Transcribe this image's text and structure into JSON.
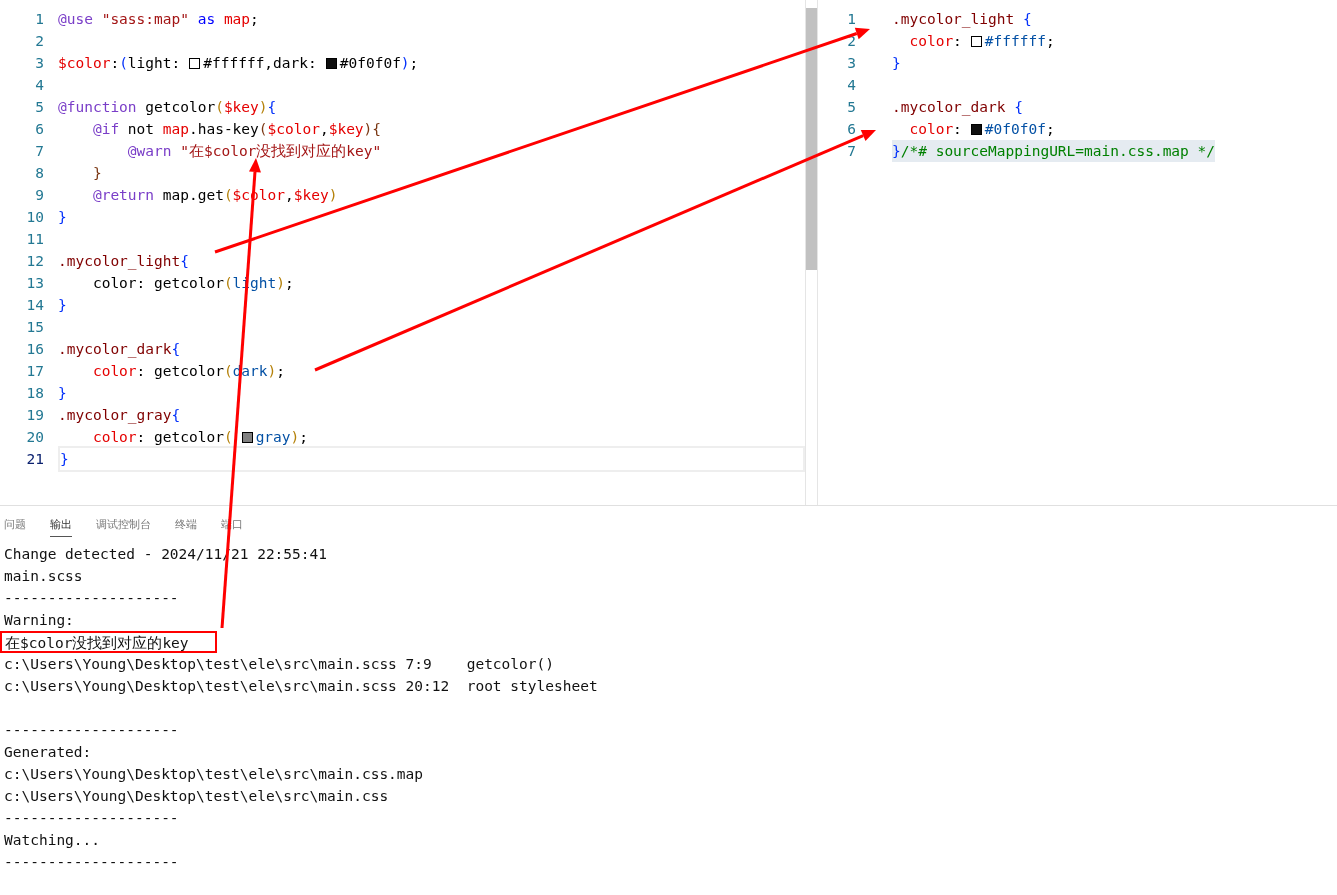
{
  "left_editor": {
    "lines": [
      {
        "number": "1",
        "current": false,
        "tokens": [
          {
            "t": "@use",
            "kind": "at"
          },
          {
            "t": " \"sass:map\"",
            "kind": "str"
          },
          {
            "t": " as",
            "kind": "kw"
          },
          {
            "t": " map",
            "kind": "var"
          },
          {
            "t": ";",
            "kind": "plain"
          }
        ]
      },
      {
        "number": "2",
        "current": false
      },
      {
        "number": "3",
        "current": false,
        "tokens": [
          {
            "t": "$color",
            "kind": "var"
          },
          {
            "t": ":",
            "kind": "plain"
          },
          {
            "t": "(",
            "kind": "b1"
          },
          {
            "t": "light:",
            "kind": "plain"
          },
          {
            "kind": "swatch",
            "color": "#ffffff"
          },
          {
            "t": "#ffffff,dark:",
            "kind": "plain"
          },
          {
            "kind": "swatch",
            "color": "#0f0f0f"
          },
          {
            "t": "#0f0f0f",
            "kind": "plain"
          },
          {
            "t": ")",
            "kind": "b1"
          },
          {
            "t": ";",
            "kind": "plain"
          }
        ]
      },
      {
        "number": "4",
        "current": false
      },
      {
        "number": "5",
        "current": false,
        "tokens": [
          {
            "t": "@function",
            "kind": "at"
          },
          {
            "t": " getcolor",
            "kind": "plain"
          },
          {
            "t": "(",
            "kind": "b2"
          },
          {
            "t": "$key",
            "kind": "var"
          },
          {
            "t": ")",
            "kind": "b2"
          },
          {
            "t": "{",
            "kind": "b1"
          }
        ]
      },
      {
        "number": "6",
        "current": false,
        "tokens": [
          {
            "t": "    @if",
            "kind": "at"
          },
          {
            "t": " not ",
            "kind": "plain"
          },
          {
            "t": "map",
            "kind": "var"
          },
          {
            "t": ".has-key",
            "kind": "plain"
          },
          {
            "t": "(",
            "kind": "b3"
          },
          {
            "t": "$color",
            "kind": "var"
          },
          {
            "t": ",",
            "kind": "plain"
          },
          {
            "t": "$key",
            "kind": "var"
          },
          {
            "t": ")",
            "kind": "b3"
          },
          {
            "t": "{",
            "kind": "b3"
          }
        ]
      },
      {
        "number": "7",
        "current": false,
        "tokens": [
          {
            "t": "        @warn",
            "kind": "at"
          },
          {
            "t": " \"在$color没找到对应的key\"",
            "kind": "str"
          }
        ]
      },
      {
        "number": "8",
        "current": false,
        "tokens": [
          {
            "t": "    }",
            "kind": "b3"
          }
        ]
      },
      {
        "number": "9",
        "current": false,
        "tokens": [
          {
            "t": "    @return",
            "kind": "at"
          },
          {
            "t": " map.get",
            "kind": "plain"
          },
          {
            "t": "(",
            "kind": "b2"
          },
          {
            "t": "$color",
            "kind": "var"
          },
          {
            "t": ",",
            "kind": "plain"
          },
          {
            "t": "$key",
            "kind": "var"
          },
          {
            "t": ")",
            "kind": "b2"
          }
        ]
      },
      {
        "number": "10",
        "current": false,
        "tokens": [
          {
            "t": "}",
            "kind": "b1"
          }
        ]
      },
      {
        "number": "11",
        "current": false
      },
      {
        "number": "12",
        "current": false,
        "tokens": [
          {
            "t": ".mycolor_light",
            "kind": "sel"
          },
          {
            "t": "{",
            "kind": "b1"
          }
        ]
      },
      {
        "number": "13",
        "current": false,
        "tokens": [
          {
            "t": "    color: getcolor",
            "kind": "plain"
          },
          {
            "t": "(",
            "kind": "b2"
          },
          {
            "t": "light",
            "kind": "val"
          },
          {
            "t": ")",
            "kind": "b2"
          },
          {
            "t": ";",
            "kind": "plain"
          }
        ]
      },
      {
        "number": "14",
        "current": false,
        "tokens": [
          {
            "t": "}",
            "kind": "b1"
          }
        ]
      },
      {
        "number": "15",
        "current": false
      },
      {
        "number": "16",
        "current": false,
        "tokens": [
          {
            "t": ".mycolor_dark",
            "kind": "sel"
          },
          {
            "t": "{",
            "kind": "b1"
          }
        ]
      },
      {
        "number": "17",
        "current": false,
        "tokens": [
          {
            "t": "    color",
            "kind": "prop"
          },
          {
            "t": ": getcolor",
            "kind": "plain"
          },
          {
            "t": "(",
            "kind": "b2"
          },
          {
            "t": "dark",
            "kind": "val"
          },
          {
            "t": ")",
            "kind": "b2"
          },
          {
            "t": ";",
            "kind": "plain"
          }
        ]
      },
      {
        "number": "18",
        "current": false,
        "tokens": [
          {
            "t": "}",
            "kind": "b1"
          }
        ]
      },
      {
        "number": "19",
        "current": false,
        "tokens": [
          {
            "t": ".mycolor_gray",
            "kind": "sel"
          },
          {
            "t": "{",
            "kind": "b1"
          }
        ]
      },
      {
        "number": "20",
        "current": false,
        "tokens": [
          {
            "t": "    color",
            "kind": "prop"
          },
          {
            "t": ": getcolor",
            "kind": "plain"
          },
          {
            "t": "(",
            "kind": "b2"
          },
          {
            "kind": "swatch",
            "color": "#808080"
          },
          {
            "t": "gray",
            "kind": "val"
          },
          {
            "t": ")",
            "kind": "b2"
          },
          {
            "t": ";",
            "kind": "plain"
          }
        ]
      },
      {
        "number": "21",
        "current": true,
        "tokens": [
          {
            "t": "}",
            "kind": "b1"
          }
        ]
      }
    ]
  },
  "right_editor": {
    "lines": [
      {
        "number": "1",
        "selected": false,
        "tokens": [
          {
            "t": ".mycolor_light",
            "kind": "sel"
          },
          {
            "t": " {",
            "kind": "b1"
          }
        ]
      },
      {
        "number": "2",
        "selected": false,
        "tokens": [
          {
            "t": "  color",
            "kind": "prop"
          },
          {
            "t": ":",
            "kind": "plain"
          },
          {
            "kind": "swatch",
            "color": "#ffffff"
          },
          {
            "t": "#ffffff",
            "kind": "val"
          },
          {
            "t": ";",
            "kind": "plain"
          }
        ]
      },
      {
        "number": "3",
        "selected": false,
        "tokens": [
          {
            "t": "}",
            "kind": "b1"
          }
        ]
      },
      {
        "number": "4",
        "selected": false
      },
      {
        "number": "5",
        "selected": false,
        "tokens": [
          {
            "t": ".mycolor_dark",
            "kind": "sel"
          },
          {
            "t": " {",
            "kind": "b1"
          }
        ]
      },
      {
        "number": "6",
        "selected": false,
        "tokens": [
          {
            "t": "  color",
            "kind": "prop"
          },
          {
            "t": ":",
            "kind": "plain"
          },
          {
            "kind": "swatch",
            "color": "#0f0f0f"
          },
          {
            "t": "#0f0f0f",
            "kind": "val"
          },
          {
            "t": ";",
            "kind": "plain"
          }
        ]
      },
      {
        "number": "7",
        "selected": true,
        "tokens": [
          {
            "t": "}",
            "kind": "b1"
          },
          {
            "t": "/*# sourceMappingURL=main.css.map */",
            "kind": "cmt"
          }
        ]
      }
    ]
  },
  "panel": {
    "tabs": [
      {
        "label": "问题",
        "selected": false
      },
      {
        "label": "输出",
        "selected": true
      },
      {
        "label": "调试控制台",
        "selected": false
      },
      {
        "label": "终端",
        "selected": false
      },
      {
        "label": "端口",
        "selected": false
      }
    ],
    "output": [
      {
        "kind": "line",
        "text": "Change detected - 2024/11/21 22:55:41"
      },
      {
        "kind": "line",
        "text": "main.scss"
      },
      {
        "kind": "line",
        "text": "--------------------"
      },
      {
        "kind": "line",
        "text": "Warning:"
      },
      {
        "kind": "boxed",
        "text": "在$color没找到对应的key"
      },
      {
        "kind": "line",
        "text": "c:\\Users\\Young\\Desktop\\test\\ele\\src\\main.scss 7:9    getcolor()"
      },
      {
        "kind": "line",
        "text": "c:\\Users\\Young\\Desktop\\test\\ele\\src\\main.scss 20:12  root stylesheet"
      },
      {
        "kind": "blank"
      },
      {
        "kind": "line",
        "text": "--------------------"
      },
      {
        "kind": "line",
        "text": "Generated:"
      },
      {
        "kind": "line",
        "text": "c:\\Users\\Young\\Desktop\\test\\ele\\src\\main.css.map"
      },
      {
        "kind": "line",
        "text": "c:\\Users\\Young\\Desktop\\test\\ele\\src\\main.css"
      },
      {
        "kind": "line",
        "text": "--------------------"
      },
      {
        "kind": "line",
        "text": "Watching..."
      },
      {
        "kind": "line",
        "text": "--------------------"
      }
    ]
  }
}
